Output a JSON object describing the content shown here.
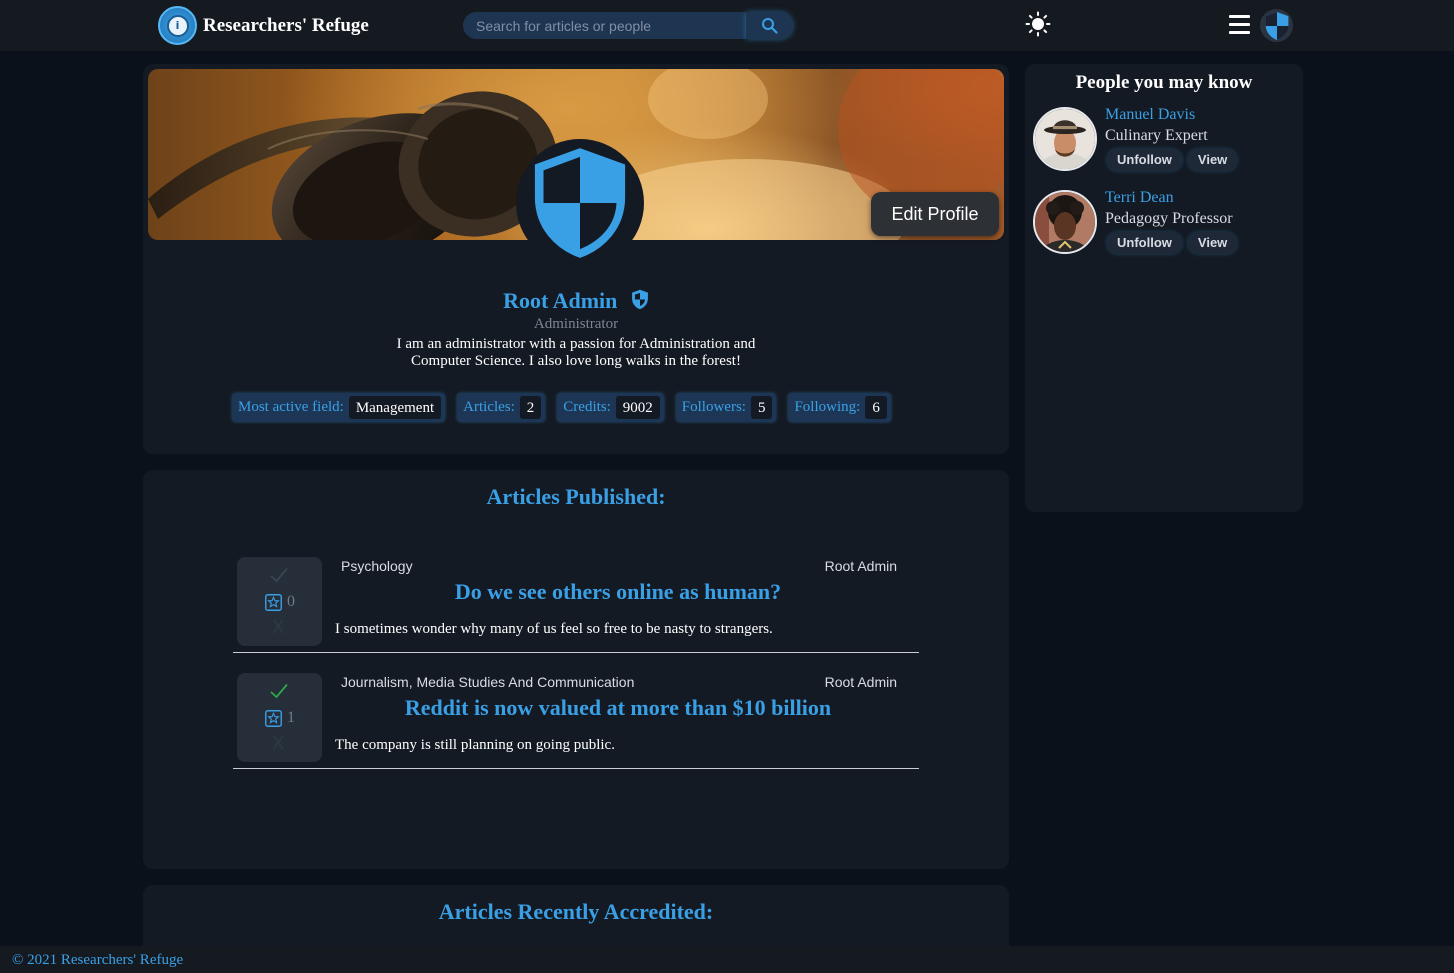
{
  "header": {
    "brand_name": "Researchers' Refuge",
    "logo_glyph": "i",
    "search_placeholder": "Search for articles or people",
    "icons": [
      "search-icon",
      "sun-icon",
      "hamburger-menu-icon",
      "shield-avatar-icon"
    ]
  },
  "profile": {
    "edit_label": "Edit Profile",
    "name": "Root Admin",
    "role": "Administrator",
    "bio": "I am an administrator with a passion for Administration and Computer Science. I also love long walks in the forest!",
    "stats": [
      {
        "label": "Most active field:",
        "value": "Management"
      },
      {
        "label": "Articles:",
        "value": "2"
      },
      {
        "label": "Credits:",
        "value": "9002"
      },
      {
        "label": "Followers:",
        "value": "5"
      },
      {
        "label": "Following:",
        "value": "6"
      }
    ]
  },
  "articles": {
    "title": "Articles Published:",
    "items": [
      {
        "category": "Psychology",
        "author": "Root Admin",
        "title": "Do we see others online as human?",
        "description": "I sometimes wonder why many of us feel so free to be nasty to strangers.",
        "score": "0",
        "upvoted": false,
        "down_label": "X"
      },
      {
        "category": "Journalism, Media Studies And Communication",
        "author": "Root Admin",
        "title": "Reddit is now valued at more than $10 billion",
        "description": "The company is still planning on going public.",
        "score": "1",
        "upvoted": true,
        "down_label": "X"
      }
    ]
  },
  "accredited": {
    "title": "Articles Recently Accredited:"
  },
  "people": {
    "title": "People you may know",
    "items": [
      {
        "name": "Manuel Davis",
        "title": "Culinary Expert",
        "unfollow_label": "Unfollow",
        "view_label": "View"
      },
      {
        "name": "Terri Dean",
        "title": "Pedagogy Professor",
        "unfollow_label": "Unfollow",
        "view_label": "View"
      }
    ]
  },
  "footer": {
    "text": "© 2021 Researchers' Refuge"
  },
  "colors": {
    "accent": "#3aa0e6",
    "background": "#0b111a",
    "card": "#141a23",
    "upvote_active": "#2ea84a"
  }
}
